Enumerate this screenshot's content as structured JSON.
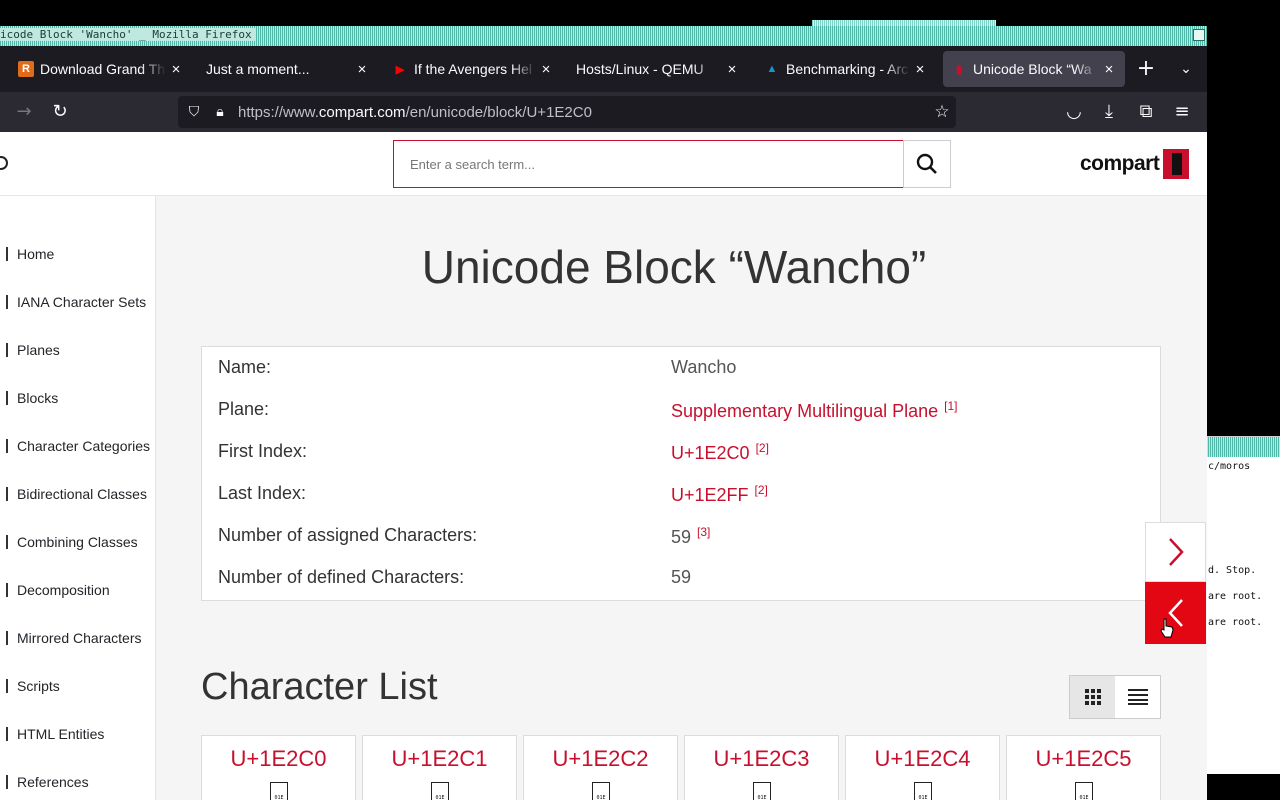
{
  "window": {
    "title": "icode Block 'Wancho' _ Mozilla Firefox"
  },
  "tabs": [
    {
      "label": "Download Grand Th",
      "favicon": "R",
      "favicon_color": "#e06c1a",
      "active": false
    },
    {
      "label": "Just a moment...",
      "favicon": "",
      "favicon_color": "",
      "active": false
    },
    {
      "label": "If the Avengers Hel",
      "favicon": "▶",
      "favicon_color": "#ff0000",
      "active": false
    },
    {
      "label": "Hosts/Linux - QEMU",
      "favicon": "",
      "favicon_color": "",
      "active": false
    },
    {
      "label": "Benchmarking - Arc",
      "favicon": "▲",
      "favicon_color": "#1793d1",
      "active": false
    },
    {
      "label": "Unicode Block “Wa",
      "favicon": "▮",
      "favicon_color": "#c8102e",
      "active": true
    }
  ],
  "urlbar": {
    "prefix": "https://www.",
    "domain": "compart.com",
    "path": "/en/unicode/block/U+1E2C0"
  },
  "search": {
    "placeholder": "Enter a search term..."
  },
  "brand": {
    "name": "compart"
  },
  "sidebar": {
    "items": [
      "Home",
      "IANA Character Sets",
      "Planes",
      "Blocks",
      "Character Categories",
      "Bidirectional Classes",
      "Combining Classes",
      "Decomposition",
      "Mirrored Characters",
      "Scripts",
      "HTML Entities",
      "References"
    ]
  },
  "page": {
    "title": "Unicode Block “Wancho”",
    "info": [
      {
        "key": "Name:",
        "value": "Wancho",
        "link": false,
        "ref": ""
      },
      {
        "key": "Plane:",
        "value": "Supplementary Multilingual Plane",
        "link": true,
        "ref": "[1]"
      },
      {
        "key": "First Index:",
        "value": "U+1E2C0",
        "link": true,
        "ref": "[2]"
      },
      {
        "key": "Last Index:",
        "value": "U+1E2FF",
        "link": true,
        "ref": "[2]"
      },
      {
        "key": "Number of assigned Characters:",
        "value": "59",
        "link": false,
        "ref": "[3]"
      },
      {
        "key": "Number of defined Characters:",
        "value": "59",
        "link": false,
        "ref": ""
      }
    ],
    "character_list_title": "Character List",
    "characters": [
      {
        "code": "U+1E2C0",
        "glyph_hex": "01E 2C0"
      },
      {
        "code": "U+1E2C1",
        "glyph_hex": "01E 2C1"
      },
      {
        "code": "U+1E2C2",
        "glyph_hex": "01E 2C2"
      },
      {
        "code": "U+1E2C3",
        "glyph_hex": "01E 2C3"
      },
      {
        "code": "U+1E2C4",
        "glyph_hex": "01E 2C4"
      },
      {
        "code": "U+1E2C5",
        "glyph_hex": "01E 2C5"
      }
    ]
  },
  "terminal": {
    "lines": [
      "c/moros",
      "d.  Stop.",
      "are root.",
      "are root."
    ]
  },
  "colors": {
    "accent": "#c8102e",
    "pager_red": "#e30613"
  }
}
